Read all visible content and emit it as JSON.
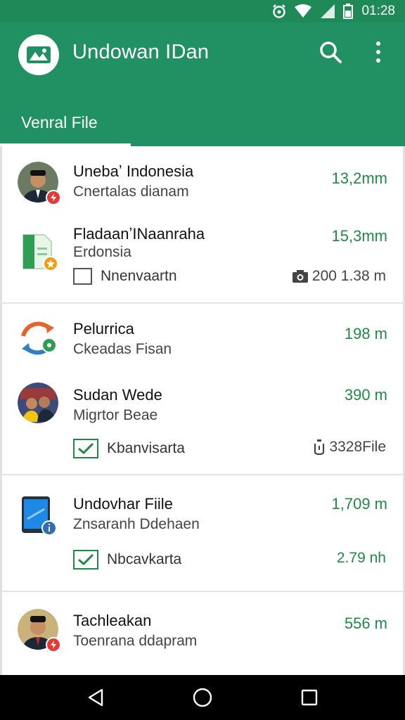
{
  "status_bar": {
    "time": "01:28",
    "icons": [
      "alarm-icon",
      "wifi-icon",
      "signal-icon",
      "battery-icon"
    ]
  },
  "app_bar": {
    "title": "Undowan  IDan",
    "logo_icon": "photo-landscape-icon",
    "actions": [
      "search-icon",
      "more-vert-icon"
    ],
    "tab": "Venral File",
    "color": "#219062"
  },
  "cards": [
    {
      "items": [
        {
          "title": "Unebaʼ Indonesia",
          "subtitle": "Cnertalas dianam",
          "size": "13,2mm",
          "avatar": "person-photo",
          "badge": "red-lightning-badge"
        },
        {
          "title": "FladaanʼINaanraha",
          "subtitle": "Erdonsia",
          "size": "15,3mm",
          "avatar": "spreadsheet-file-icon",
          "badge": "orange-star-badge",
          "check": {
            "label": "Nnenvaartn",
            "checked": false
          },
          "meta": {
            "icon": "camera-icon",
            "text": "200 1.38 m"
          }
        }
      ]
    },
    {
      "items": [
        {
          "title": "Pelurrica",
          "subtitle": "Ckeadas Fisan",
          "size": "198 m",
          "avatar": "sync-arrows-icon",
          "badge": "green-check-badge"
        },
        {
          "title": "Sudan Wede",
          "subtitle": "Migrtor Beae",
          "size": "390 m",
          "avatar": "group-photo",
          "check": {
            "label": "Kbanvisarta",
            "checked": true
          },
          "meta": {
            "icon": "timer-icon",
            "text": "3328File"
          }
        }
      ]
    },
    {
      "items": [
        {
          "title": "Undovhar Fiile",
          "subtitle": "Znsaranh Ddehaen",
          "size": "1,709 m",
          "avatar": "tablet-device-icon",
          "badge": "blue-info-badge",
          "check": {
            "label": "Nbcavkarta",
            "checked": true
          },
          "meta": {
            "text": "2.79 nh"
          }
        }
      ]
    },
    {
      "items": [
        {
          "title": "Tachleakan",
          "subtitle": "Toenrana ddapram",
          "size": "556 m",
          "avatar": "person-photo",
          "badge": "red-lightning-badge"
        }
      ]
    }
  ],
  "nav_bar": [
    "back-icon",
    "home-icon",
    "recents-icon"
  ]
}
